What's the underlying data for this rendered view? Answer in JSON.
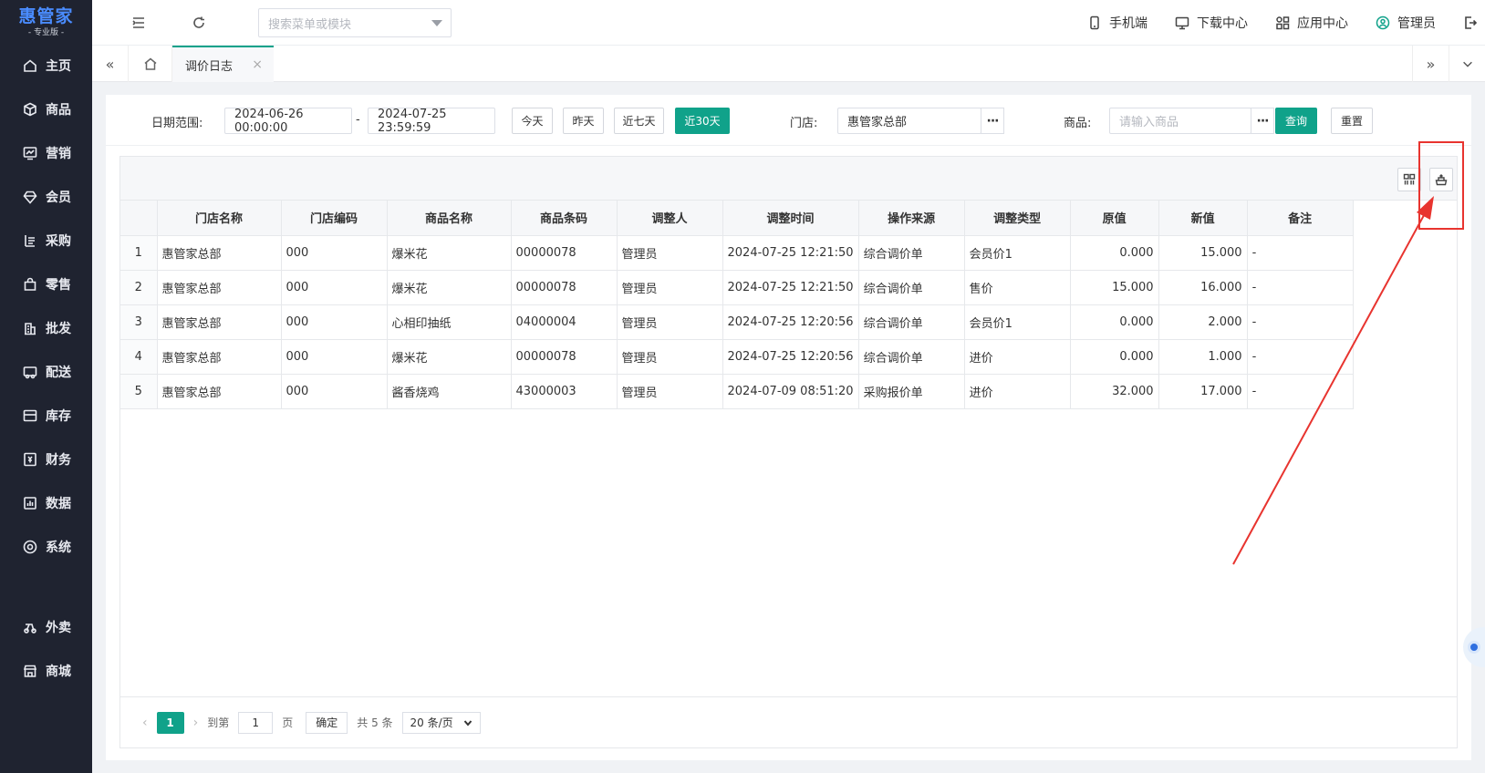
{
  "sidebar": {
    "brand": "惠管家",
    "edition": "- 专业版 -",
    "items": [
      {
        "label": "主页",
        "icon": "home-icon"
      },
      {
        "label": "商品",
        "icon": "box-icon"
      },
      {
        "label": "营销",
        "icon": "chart-icon"
      },
      {
        "label": "会员",
        "icon": "diamond-icon"
      },
      {
        "label": "采购",
        "icon": "list-icon"
      },
      {
        "label": "零售",
        "icon": "bag-icon"
      },
      {
        "label": "批发",
        "icon": "building-icon"
      },
      {
        "label": "配送",
        "icon": "truck-icon"
      },
      {
        "label": "库存",
        "icon": "warehouse-icon"
      },
      {
        "label": "财务",
        "icon": "finance-icon"
      },
      {
        "label": "数据",
        "icon": "data-icon"
      },
      {
        "label": "系统",
        "icon": "settings-icon"
      }
    ],
    "extra_items": [
      {
        "label": "外卖",
        "icon": "delivery-icon"
      },
      {
        "label": "商城",
        "icon": "store-icon"
      }
    ]
  },
  "header": {
    "search_placeholder": "搜索菜单或模块",
    "links": [
      {
        "label": "手机端",
        "icon": "mobile-icon"
      },
      {
        "label": "下载中心",
        "icon": "download-icon"
      },
      {
        "label": "应用中心",
        "icon": "apps-icon"
      },
      {
        "label": "管理员",
        "icon": "user-icon"
      }
    ]
  },
  "tabs": {
    "active": "调价日志",
    "left_arrow": "«",
    "right_arrow": "»",
    "close": "×"
  },
  "filters": {
    "date_label": "日期范围:",
    "date_start": "2024-06-26 00:00:00",
    "date_sep": "-",
    "date_end": "2024-07-25 23:59:59",
    "quick": [
      "今天",
      "昨天",
      "近七天",
      "近30天"
    ],
    "store_label": "门店:",
    "store_value": "惠管家总部",
    "goods_label": "商品:",
    "goods_placeholder": "请输入商品",
    "more": "···",
    "query": "查询",
    "reset": "重置"
  },
  "table": {
    "columns": [
      "",
      "门店名称",
      "门店编码",
      "商品名称",
      "商品条码",
      "调整人",
      "调整时间",
      "操作来源",
      "调整类型",
      "原值",
      "新值",
      "备注"
    ],
    "rows": [
      [
        "1",
        "惠管家总部",
        "000",
        "爆米花",
        "00000078",
        "管理员",
        "2024-07-25 12:21:50",
        "综合调价单",
        "会员价1",
        "0.000",
        "15.000",
        "-"
      ],
      [
        "2",
        "惠管家总部",
        "000",
        "爆米花",
        "00000078",
        "管理员",
        "2024-07-25 12:21:50",
        "综合调价单",
        "售价",
        "15.000",
        "16.000",
        "-"
      ],
      [
        "3",
        "惠管家总部",
        "000",
        "心相印抽纸",
        "04000004",
        "管理员",
        "2024-07-25 12:20:56",
        "综合调价单",
        "会员价1",
        "0.000",
        "2.000",
        "-"
      ],
      [
        "4",
        "惠管家总部",
        "000",
        "爆米花",
        "00000078",
        "管理员",
        "2024-07-25 12:20:56",
        "综合调价单",
        "进价",
        "0.000",
        "1.000",
        "-"
      ],
      [
        "5",
        "惠管家总部",
        "000",
        "酱香烧鸡",
        "43000003",
        "管理员",
        "2024-07-09 08:51:20",
        "采购报价单",
        "进价",
        "32.000",
        "17.000",
        "-"
      ]
    ]
  },
  "pager": {
    "prev": "‹",
    "current": "1",
    "next": "›",
    "goto_label": "到第",
    "goto_value": "1",
    "page_unit": "页",
    "confirm": "确定",
    "total": "共 5 条",
    "page_size": "20 条/页"
  },
  "colors": {
    "accent": "#10a28a",
    "sidebar_bg": "#1f2330",
    "annotation": "#e8342f"
  }
}
